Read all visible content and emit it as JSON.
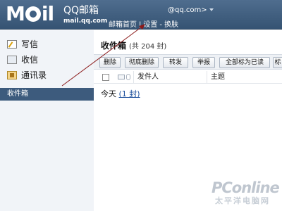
{
  "header": {
    "logo": "M il",
    "brand": "QQ邮箱",
    "domain": "mail.qq.com",
    "account": "@qq.com>",
    "links": [
      "邮箱首页",
      "设置",
      "换肤"
    ]
  },
  "sidebar": {
    "items": [
      {
        "label": "写信",
        "icon": "compose-icon"
      },
      {
        "label": "收信",
        "icon": "inbox-icon"
      },
      {
        "label": "通讯录",
        "icon": "contacts-icon"
      }
    ],
    "selected_folder": "收件箱"
  },
  "main": {
    "title": "收件箱",
    "count_text": "(共 204 封)",
    "toolbar": [
      "删除",
      "彻底删除",
      "转发",
      "举报",
      "全部标为已读",
      "标"
    ],
    "columns": {
      "sender": "发件人",
      "subject": "主题"
    },
    "group": {
      "label": "今天",
      "count_link": "(1 封)"
    }
  },
  "watermark": {
    "main": "PConline",
    "sub": "太平洋电脑网"
  }
}
